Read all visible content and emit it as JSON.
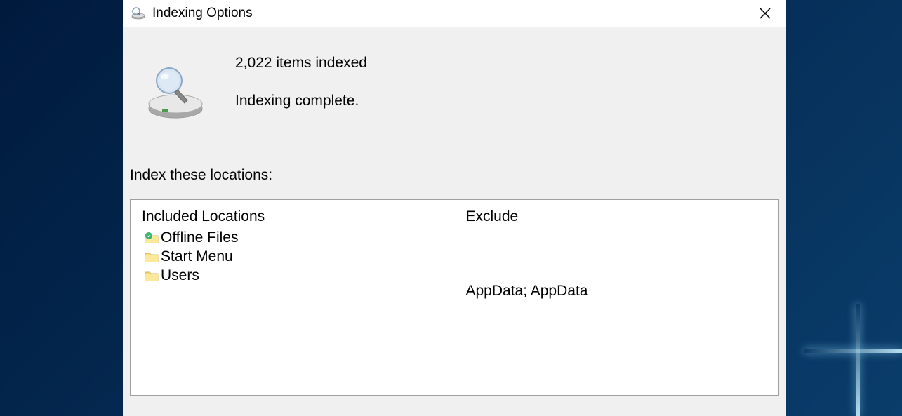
{
  "window": {
    "title": "Indexing Options"
  },
  "status": {
    "count_text": "2,022 items indexed",
    "message": "Indexing complete."
  },
  "locations": {
    "label": "Index these locations:",
    "included_header": "Included Locations",
    "exclude_header": "Exclude",
    "items": [
      {
        "label": "Offline Files",
        "exclude": "",
        "icon": "offline-files"
      },
      {
        "label": "Start Menu",
        "exclude": "",
        "icon": "folder"
      },
      {
        "label": "Users",
        "exclude": "AppData; AppData",
        "icon": "folder"
      }
    ]
  }
}
